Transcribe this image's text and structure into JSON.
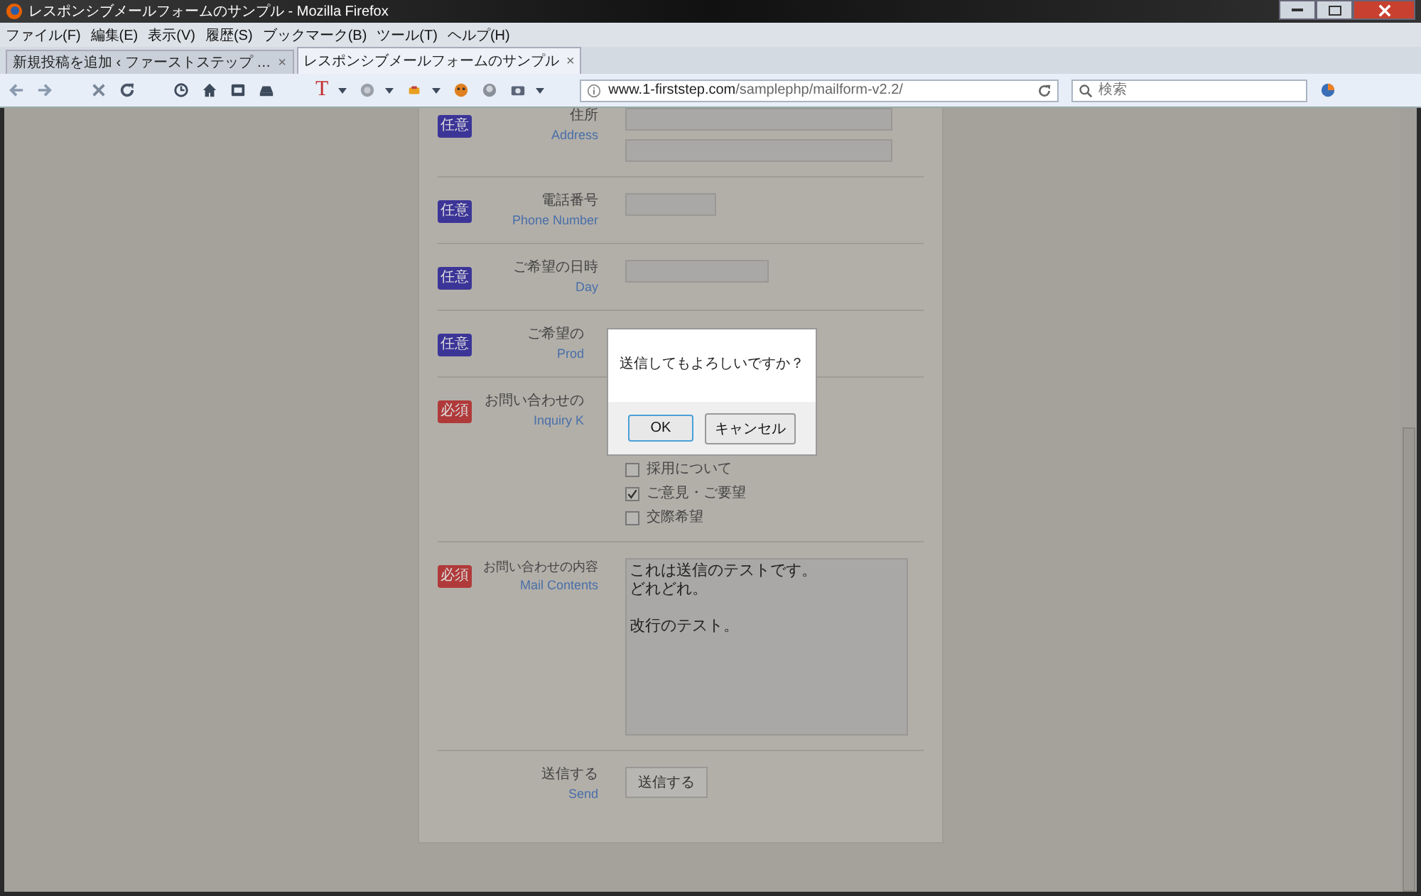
{
  "window": {
    "title": "レスポンシブメールフォームのサンプル - Mozilla Firefox"
  },
  "menu": [
    "ファイル(F)",
    "編集(E)",
    "表示(V)",
    "履歴(S)",
    "ブックマーク(B)",
    "ツール(T)",
    "ヘルプ(H)"
  ],
  "tabs": [
    {
      "label": "新規投稿を追加 ‹ ファーストステップ …",
      "selected": false
    },
    {
      "label": "レスポンシブメールフォームのサンプル",
      "selected": true
    }
  ],
  "tab_close": "×",
  "toolbar": {
    "text_tool": "T"
  },
  "address_bar": {
    "host": "www.1-firststep.com",
    "path": "/samplephp/mailform-v2.2/"
  },
  "search": {
    "placeholder": "検索"
  },
  "form": {
    "rows": [
      {
        "kind": "address",
        "badge": "任意",
        "required": false,
        "label": "住所",
        "label_en": "Address"
      },
      {
        "kind": "short",
        "badge": "任意",
        "required": false,
        "label": "電話番号",
        "label_en": "Phone Number"
      },
      {
        "kind": "medium",
        "badge": "任意",
        "required": false,
        "label": "ご希望の日時",
        "label_en": "Day"
      },
      {
        "kind": "hidden",
        "badge": "任意",
        "required": false,
        "label": "ご希望の",
        "label_en": "Prod"
      },
      {
        "kind": "checkboxes",
        "badge": "必須",
        "required": true,
        "label": "お問い合わせの",
        "label_en": "Inquiry K",
        "options": [
          {
            "label": "採用について",
            "checked": false
          },
          {
            "label": "ご意見・ご要望",
            "checked": true
          },
          {
            "label": "交際希望",
            "checked": false
          }
        ]
      },
      {
        "kind": "textarea",
        "badge": "必須",
        "required": true,
        "label": "お問い合わせの内容",
        "label_en": "Mail Contents",
        "lines": [
          "これは送信のテストです。",
          "どれどれ。",
          "改行のテスト。"
        ]
      },
      {
        "kind": "submit",
        "label": "送信する",
        "label_en": "Send",
        "button": "送信する"
      }
    ]
  },
  "dialog": {
    "message": "送信してもよろしいですか？",
    "buttons": [
      {
        "label": "OK",
        "default": true
      },
      {
        "label": "キャンセル",
        "default": false
      }
    ]
  }
}
